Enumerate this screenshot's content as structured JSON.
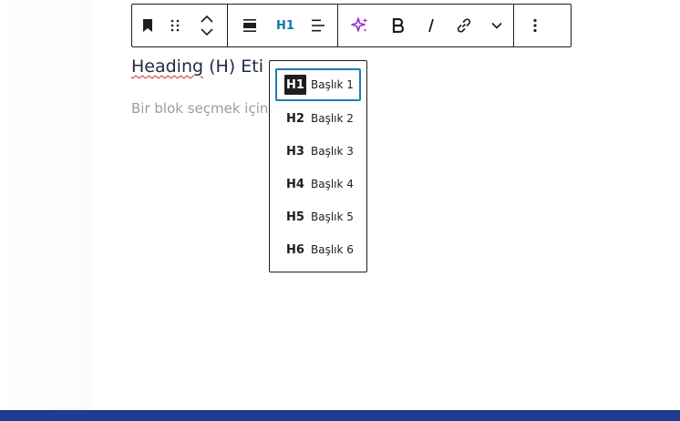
{
  "toolbar": {
    "heading_level_label": "H1",
    "icons": [
      "bookmark-icon",
      "drag-handle-icon",
      "move-up-icon",
      "move-down-icon",
      "align-icon",
      "text-align-left-icon",
      "ai-sparkle-icon",
      "bold-icon",
      "italic-icon",
      "link-icon",
      "chevron-down-icon",
      "more-options-icon"
    ],
    "accent_color": "#0a7aa0",
    "sparkle_color": "#9b30c8"
  },
  "editor": {
    "heading_word": "Heading",
    "heading_rest": " (H) Eti",
    "placeholder": "Bir blok seçmek için"
  },
  "heading_dropdown": {
    "items": [
      {
        "badge": "H1",
        "label": "Başlık 1",
        "selected": true
      },
      {
        "badge": "H2",
        "label": "Başlık 2",
        "selected": false
      },
      {
        "badge": "H3",
        "label": "Başlık 3",
        "selected": false
      },
      {
        "badge": "H4",
        "label": "Başlık 4",
        "selected": false
      },
      {
        "badge": "H5",
        "label": "Başlık 5",
        "selected": false
      },
      {
        "badge": "H6",
        "label": "Başlık 6",
        "selected": false
      }
    ]
  },
  "colors": {
    "bottom_bar": "#1e3d8f",
    "focus_ring": "#1a7eb0"
  }
}
